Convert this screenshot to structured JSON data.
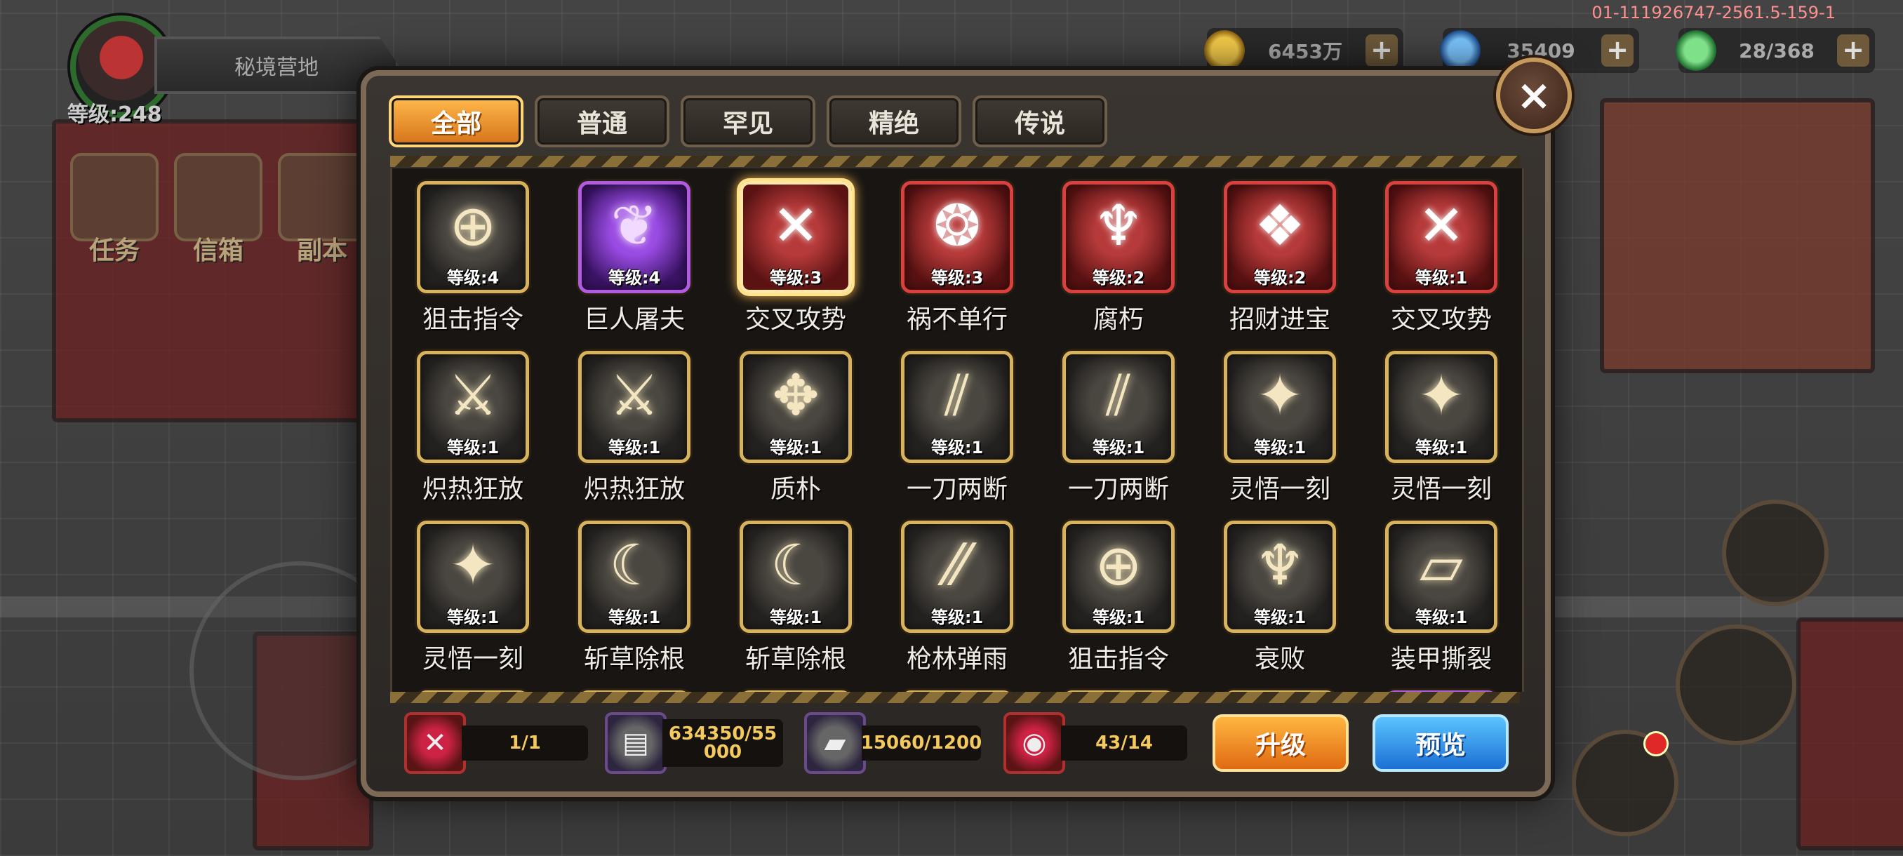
{
  "server_id": "01-111926747-2561.5-159-1",
  "player": {
    "location": "秘境营地",
    "level_label": "等级:248"
  },
  "quick_buttons": [
    {
      "label": "任务"
    },
    {
      "label": "信箱"
    },
    {
      "label": "副本"
    }
  ],
  "resources": [
    {
      "name": "gold",
      "value": "6453万",
      "color": "#d9a520"
    },
    {
      "name": "diamond",
      "value": "35409",
      "color": "#3a8de0"
    },
    {
      "name": "energy",
      "value": "28/368",
      "color": "#2fb84a"
    }
  ],
  "tabs": [
    {
      "label": "全部",
      "active": true
    },
    {
      "label": "普通",
      "active": false
    },
    {
      "label": "罕见",
      "active": false
    },
    {
      "label": "精绝",
      "active": false
    },
    {
      "label": "传说",
      "active": false
    }
  ],
  "skills": [
    {
      "name": "狙击指令",
      "level": "等级:4",
      "rarity": "gold",
      "icon": "crosshair-icon",
      "glyph": "⊕"
    },
    {
      "name": "巨人屠夫",
      "level": "等级:4",
      "rarity": "purple",
      "icon": "crystal-blade-icon",
      "glyph": "❦"
    },
    {
      "name": "交叉攻势",
      "level": "等级:3",
      "rarity": "red",
      "icon": "crossed-swords-icon",
      "glyph": "✕",
      "selected": true
    },
    {
      "name": "祸不单行",
      "level": "等级:3",
      "rarity": "red",
      "icon": "spiral-icon",
      "glyph": "❂"
    },
    {
      "name": "腐朽",
      "level": "等级:2",
      "rarity": "red",
      "icon": "dead-tree-icon",
      "glyph": "♆"
    },
    {
      "name": "招财进宝",
      "level": "等级:2",
      "rarity": "red",
      "icon": "grid-emblem-icon",
      "glyph": "❖"
    },
    {
      "name": "交叉攻势",
      "level": "等级:1",
      "rarity": "red",
      "icon": "crossed-swords-icon",
      "glyph": "✕"
    },
    {
      "name": "炽热狂放",
      "level": "等级:1",
      "rarity": "gold",
      "icon": "flaming-blade-icon",
      "glyph": "⚔"
    },
    {
      "name": "炽热狂放",
      "level": "等级:1",
      "rarity": "gold",
      "icon": "flaming-blade-icon",
      "glyph": "⚔"
    },
    {
      "name": "质朴",
      "level": "等级:1",
      "rarity": "gold",
      "icon": "crossbow-icon",
      "glyph": "✥"
    },
    {
      "name": "一刀两断",
      "level": "等级:1",
      "rarity": "gold",
      "icon": "slash-icon",
      "glyph": "⫽"
    },
    {
      "name": "一刀两断",
      "level": "等级:1",
      "rarity": "gold",
      "icon": "slash-icon",
      "glyph": "⫽"
    },
    {
      "name": "灵悟一刻",
      "level": "等级:1",
      "rarity": "gold",
      "icon": "star-burst-icon",
      "glyph": "✦"
    },
    {
      "name": "灵悟一刻",
      "level": "等级:1",
      "rarity": "gold",
      "icon": "star-burst-icon",
      "glyph": "✦"
    },
    {
      "name": "灵悟一刻",
      "level": "等级:1",
      "rarity": "gold",
      "icon": "star-burst-icon",
      "glyph": "✦"
    },
    {
      "name": "斩草除根",
      "level": "等级:1",
      "rarity": "gold",
      "icon": "scythe-icon",
      "glyph": "☾"
    },
    {
      "name": "斩草除根",
      "level": "等级:1",
      "rarity": "gold",
      "icon": "scythe-icon",
      "glyph": "☾"
    },
    {
      "name": "枪林弹雨",
      "level": "等级:1",
      "rarity": "gold",
      "icon": "bullet-rain-icon",
      "glyph": "⁄⁄"
    },
    {
      "name": "狙击指令",
      "level": "等级:1",
      "rarity": "gold",
      "icon": "crosshair-icon",
      "glyph": "⊕"
    },
    {
      "name": "衰败",
      "level": "等级:1",
      "rarity": "gold",
      "icon": "dead-tree-icon",
      "glyph": "♆"
    },
    {
      "name": "装甲撕裂",
      "level": "等级:1",
      "rarity": "gold",
      "icon": "torn-armor-icon",
      "glyph": "▱"
    }
  ],
  "partial_row_rarities": [
    "gold",
    "gold",
    "gold",
    "gold",
    "gold",
    "gold",
    "purple"
  ],
  "bottom_bar": {
    "skill_count": "1/1",
    "material_a": "634350/55000",
    "material_b": "15060/1200",
    "material_c": "43/14",
    "upgrade_label": "升级",
    "preview_label": "预览"
  },
  "colors": {
    "accent_orange": "#e07a1a",
    "accent_blue": "#1c6fd4",
    "frame_gold": "#d7b35e",
    "rarity_red": "#d94040",
    "rarity_purple": "#b15ce0"
  }
}
